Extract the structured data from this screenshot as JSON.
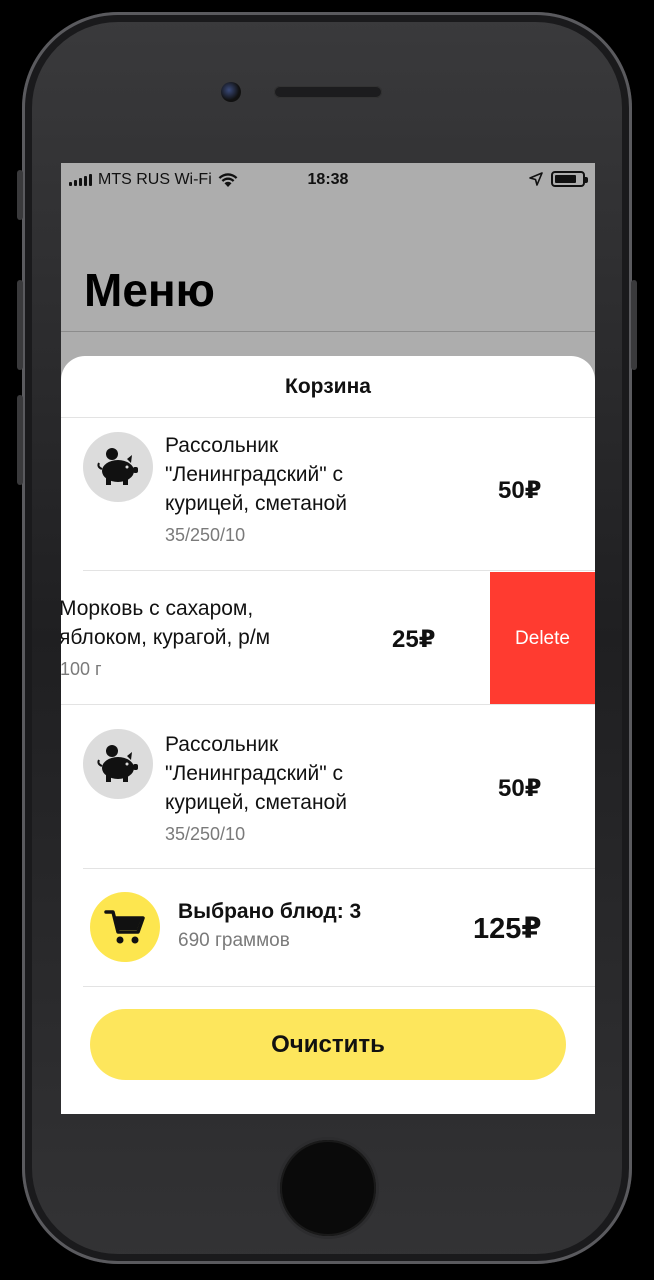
{
  "status_bar": {
    "carrier": "MTS RUS Wi-Fi",
    "time": "18:38",
    "battery_level": 0.8,
    "icons": [
      "signal-icon",
      "wifi-icon",
      "location-arrow-icon",
      "battery-icon"
    ]
  },
  "background": {
    "title": "Меню"
  },
  "cart": {
    "title": "Корзина",
    "items": [
      {
        "name_lines": [
          "Рассольник",
          "\"Ленинградский\" с",
          "курицей, сметаной"
        ],
        "weight": "35/250/10",
        "price": "50₽",
        "icon": "pig-icon"
      },
      {
        "name_lines": [
          "Морковь с сахаром,",
          "яблоком, курагой, р/м"
        ],
        "weight": "100 г",
        "price": "25₽",
        "delete_label": "Delete"
      },
      {
        "name_lines": [
          "Рассольник",
          "\"Ленинградский\" с",
          "курицей, сметаной"
        ],
        "weight": "35/250/10",
        "price": "50₽",
        "icon": "pig-icon"
      }
    ],
    "summary": {
      "title": "Выбрано блюд: 3",
      "grams": "690 граммов",
      "total": "125₽",
      "icon": "cart-icon"
    },
    "clear_label": "Очистить"
  },
  "colors": {
    "accent_yellow": "#fde65c",
    "delete_red": "#ff3b30",
    "overlay_gray": "#adadad"
  }
}
